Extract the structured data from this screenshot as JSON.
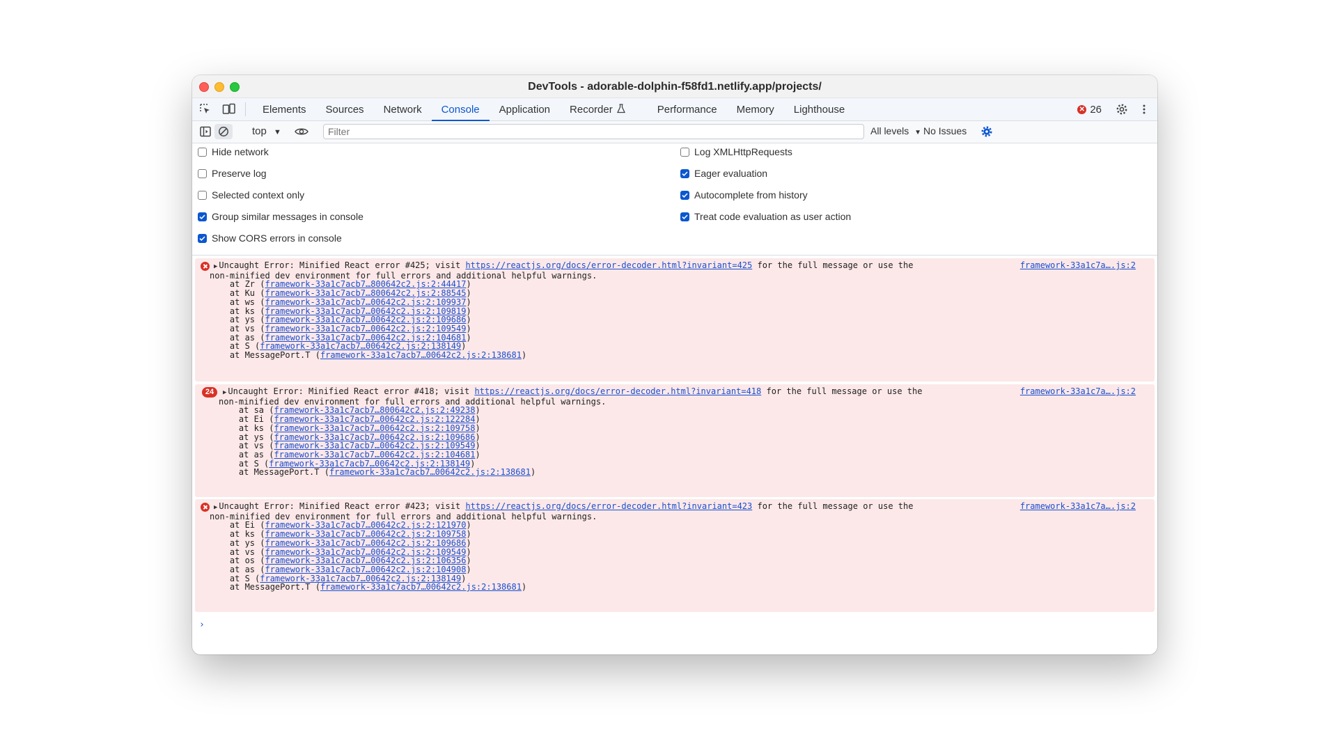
{
  "window": {
    "title": "DevTools - adorable-dolphin-f58fd1.netlify.app/projects/"
  },
  "tabbar": {
    "tabs": [
      "Elements",
      "Sources",
      "Network",
      "Console",
      "Application",
      "Recorder",
      "Performance",
      "Memory",
      "Lighthouse"
    ],
    "active_tab": "Console",
    "error_count": "26",
    "icons": [
      "inspect-element-icon",
      "device-toolbar-icon",
      "flask-icon",
      "error-icon",
      "gear-icon",
      "more-vertical-icon"
    ]
  },
  "toolbar": {
    "context": "top",
    "filter_placeholder": "Filter",
    "levels": "All levels",
    "issues": "No Issues",
    "icons": [
      "sidebar-toggle-icon",
      "clear-console-icon",
      "eye-icon",
      "settings-gear-icon"
    ]
  },
  "settings": {
    "left": [
      {
        "label": "Hide network",
        "checked": false
      },
      {
        "label": "Preserve log",
        "checked": false
      },
      {
        "label": "Selected context only",
        "checked": false
      },
      {
        "label": "Group similar messages in console",
        "checked": true
      },
      {
        "label": "Show CORS errors in console",
        "checked": true
      }
    ],
    "right": [
      {
        "label": "Log XMLHttpRequests",
        "checked": false
      },
      {
        "label": "Eager evaluation",
        "checked": true
      },
      {
        "label": "Autocomplete from history",
        "checked": true
      },
      {
        "label": "Treat code evaluation as user action",
        "checked": true
      }
    ]
  },
  "console": {
    "messages": [
      {
        "badge": "",
        "prefix": "Uncaught Error: Minified React error #425; visit ",
        "url": "https://reactjs.org/docs/error-decoder.html?invariant=425",
        "suffix": " for the full message or use the",
        "line2": "non-minified dev environment for full errors and additional helpful warnings.",
        "source": "framework-33a1c7a….js:2",
        "stack": [
          {
            "fn": "    at Zr (",
            "link": "framework-33a1c7acb7…800642c2.js:2:44417",
            "end": ")"
          },
          {
            "fn": "    at Ku (",
            "link": "framework-33a1c7acb7…800642c2.js:2:88545",
            "end": ")"
          },
          {
            "fn": "    at ws (",
            "link": "framework-33a1c7acb7…00642c2.js:2:109937",
            "end": ")"
          },
          {
            "fn": "    at ks (",
            "link": "framework-33a1c7acb7…00642c2.js:2:109819",
            "end": ")"
          },
          {
            "fn": "    at ys (",
            "link": "framework-33a1c7acb7…00642c2.js:2:109686",
            "end": ")"
          },
          {
            "fn": "    at vs (",
            "link": "framework-33a1c7acb7…00642c2.js:2:109549",
            "end": ")"
          },
          {
            "fn": "    at as (",
            "link": "framework-33a1c7acb7…00642c2.js:2:104681",
            "end": ")"
          },
          {
            "fn": "    at S (",
            "link": "framework-33a1c7acb7…00642c2.js:2:138149",
            "end": ")"
          },
          {
            "fn": "    at MessagePort.T (",
            "link": "framework-33a1c7acb7…00642c2.js:2:138681",
            "end": ")"
          }
        ]
      },
      {
        "badge": "24",
        "prefix": "Uncaught Error: Minified React error #418; visit ",
        "url": "https://reactjs.org/docs/error-decoder.html?invariant=418",
        "suffix": " for the full message or use the",
        "line2": "non-minified dev environment for full errors and additional helpful warnings.",
        "source": "framework-33a1c7a….js:2",
        "stack": [
          {
            "fn": "    at sa (",
            "link": "framework-33a1c7acb7…800642c2.js:2:49238",
            "end": ")"
          },
          {
            "fn": "    at Ei (",
            "link": "framework-33a1c7acb7…00642c2.js:2:122284",
            "end": ")"
          },
          {
            "fn": "    at ks (",
            "link": "framework-33a1c7acb7…00642c2.js:2:109758",
            "end": ")"
          },
          {
            "fn": "    at ys (",
            "link": "framework-33a1c7acb7…00642c2.js:2:109686",
            "end": ")"
          },
          {
            "fn": "    at vs (",
            "link": "framework-33a1c7acb7…00642c2.js:2:109549",
            "end": ")"
          },
          {
            "fn": "    at as (",
            "link": "framework-33a1c7acb7…00642c2.js:2:104681",
            "end": ")"
          },
          {
            "fn": "    at S (",
            "link": "framework-33a1c7acb7…00642c2.js:2:138149",
            "end": ")"
          },
          {
            "fn": "    at MessagePort.T (",
            "link": "framework-33a1c7acb7…00642c2.js:2:138681",
            "end": ")"
          }
        ]
      },
      {
        "badge": "",
        "prefix": "Uncaught Error: Minified React error #423; visit ",
        "url": "https://reactjs.org/docs/error-decoder.html?invariant=423",
        "suffix": " for the full message or use the",
        "line2": "non-minified dev environment for full errors and additional helpful warnings.",
        "source": "framework-33a1c7a….js:2",
        "stack": [
          {
            "fn": "    at Ei (",
            "link": "framework-33a1c7acb7…00642c2.js:2:121970",
            "end": ")"
          },
          {
            "fn": "    at ks (",
            "link": "framework-33a1c7acb7…00642c2.js:2:109758",
            "end": ")"
          },
          {
            "fn": "    at ys (",
            "link": "framework-33a1c7acb7…00642c2.js:2:109686",
            "end": ")"
          },
          {
            "fn": "    at vs (",
            "link": "framework-33a1c7acb7…00642c2.js:2:109549",
            "end": ")"
          },
          {
            "fn": "    at os (",
            "link": "framework-33a1c7acb7…00642c2.js:2:106356",
            "end": ")"
          },
          {
            "fn": "    at as (",
            "link": "framework-33a1c7acb7…00642c2.js:2:104908",
            "end": ")"
          },
          {
            "fn": "    at S (",
            "link": "framework-33a1c7acb7…00642c2.js:2:138149",
            "end": ")"
          },
          {
            "fn": "    at MessagePort.T (",
            "link": "framework-33a1c7acb7…00642c2.js:2:138681",
            "end": ")"
          }
        ]
      }
    ],
    "prompt": "›"
  },
  "colors": {
    "accent": "#0b57d0",
    "error": "#d93025",
    "error_bg": "#fce8e8"
  }
}
